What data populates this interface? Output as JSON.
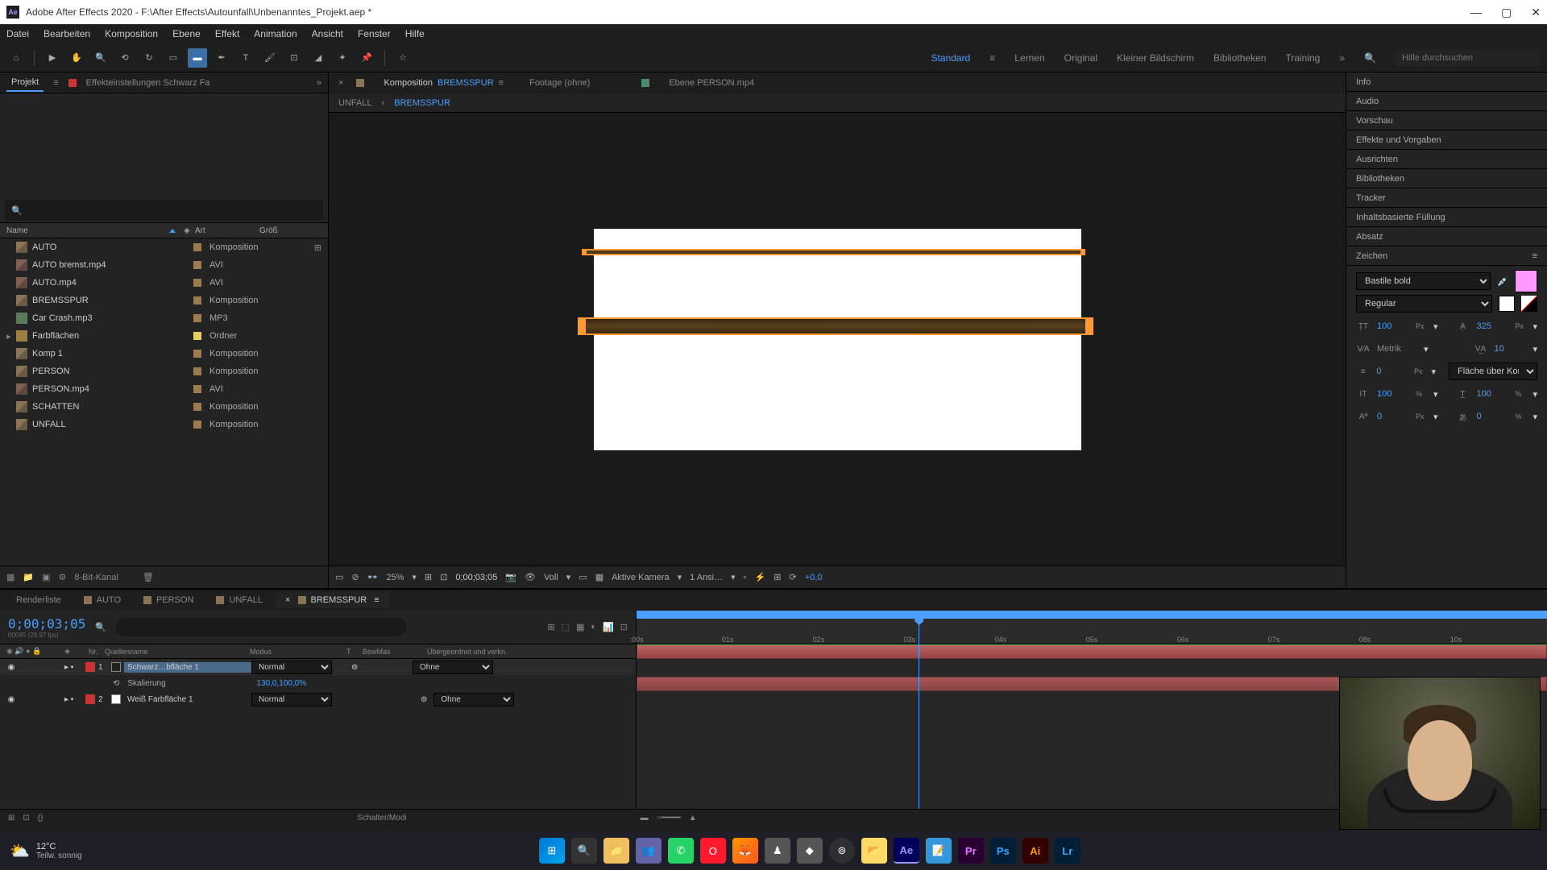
{
  "titlebar": {
    "app": "Adobe After Effects 2020",
    "path": "F:\\After Effects\\Autounfall\\Unbenanntes_Projekt.aep *"
  },
  "menubar": [
    "Datei",
    "Bearbeiten",
    "Komposition",
    "Ebene",
    "Effekt",
    "Animation",
    "Ansicht",
    "Fenster",
    "Hilfe"
  ],
  "workspaces": {
    "items": [
      "Standard",
      "Lernen",
      "Original",
      "Kleiner Bildschirm",
      "Bibliotheken",
      "Training"
    ],
    "active": "Standard",
    "search_placeholder": "Hilfe durchsuchen"
  },
  "project": {
    "tab": "Projekt",
    "effect_settings": "Effekteinstellungen Schwarz Fa",
    "columns": {
      "name": "Name",
      "type": "Art",
      "size": "Größ"
    },
    "items": [
      {
        "name": "AUTO",
        "type": "Komposition",
        "color": "#9e7b4f",
        "icon": "comp",
        "has_sub": true
      },
      {
        "name": "AUTO bremst.mp4",
        "type": "AVI",
        "color": "#9e7b4f",
        "icon": "avi"
      },
      {
        "name": "AUTO.mp4",
        "type": "AVI",
        "color": "#9e7b4f",
        "icon": "avi"
      },
      {
        "name": "BREMSSPUR",
        "type": "Komposition",
        "color": "#9e7b4f",
        "icon": "comp"
      },
      {
        "name": "Car Crash.mp3",
        "type": "MP3",
        "color": "#9e7b4f",
        "icon": "mp3"
      },
      {
        "name": "Farbflächen",
        "type": "Ordner",
        "color": "#e8d060",
        "icon": "folder",
        "expandable": true
      },
      {
        "name": "Komp 1",
        "type": "Komposition",
        "color": "#9e7b4f",
        "icon": "comp"
      },
      {
        "name": "PERSON",
        "type": "Komposition",
        "color": "#9e7b4f",
        "icon": "comp"
      },
      {
        "name": "PERSON.mp4",
        "type": "AVI",
        "color": "#9e7b4f",
        "icon": "avi"
      },
      {
        "name": "SCHATTEN",
        "type": "Komposition",
        "color": "#9e7b4f",
        "icon": "comp"
      },
      {
        "name": "UNFALL",
        "type": "Komposition",
        "color": "#9e7b4f",
        "icon": "comp"
      }
    ],
    "bit_depth": "8-Bit-Kanal"
  },
  "comp": {
    "tab_prefix": "Komposition",
    "tab_name": "BREMSSPUR",
    "footage_tab": "Footage   (ohne)",
    "layer_tab": "Ebene  PERSON.mp4",
    "nav": {
      "parent": "UNFALL",
      "current": "BREMSSPUR"
    },
    "footer": {
      "zoom": "25%",
      "timecode": "0;00;03;05",
      "resolution": "Voll",
      "camera": "Aktive Kamera",
      "views": "1 Ansi…",
      "exposure": "+0,0"
    }
  },
  "right_panels": [
    "Info",
    "Audio",
    "Vorschau",
    "Effekte und Vorgaben",
    "Ausrichten",
    "Bibliotheken",
    "Tracker",
    "Inhaltsbasierte Füllung",
    "Absatz"
  ],
  "character": {
    "title": "Zeichen",
    "font": "Bastile bold",
    "style": "Regular",
    "size": "100",
    "size_unit": "Px",
    "leading": "325",
    "leading_unit": "Px",
    "kerning": "Metrik",
    "tracking": "10",
    "stroke": "0",
    "stroke_unit": "Px",
    "stroke_mode": "Fläche über Kon…",
    "vscale": "100",
    "vscale_unit": "%",
    "hscale": "100",
    "hscale_unit": "%",
    "baseline": "0",
    "baseline_unit": "Px",
    "tsume": "0",
    "tsume_unit": "%",
    "fill_color": "#ff99ff"
  },
  "timeline": {
    "tabs": [
      "Renderliste",
      "AUTO",
      "PERSON",
      "UNFALL",
      "BREMSSPUR"
    ],
    "active_tab": "BREMSSPUR",
    "timecode": "0;00;03;05",
    "frame_info": "00095 (29.97 fps)",
    "columns": {
      "num": "Nr.",
      "name": "Quellenname",
      "mode": "Modus",
      "t": "T",
      "bew": "BewMas",
      "parent": "Übergeordnet und verkn."
    },
    "layers": [
      {
        "num": "1",
        "name": "Schwarz…bfläche 1",
        "mode": "Normal",
        "parent": "Ohne",
        "color": "#cc3333",
        "selected": true
      },
      {
        "num": "2",
        "name": "Weiß Farbfläche 1",
        "mode": "Normal",
        "parent": "Ohne",
        "color": "#cc3333"
      }
    ],
    "property": {
      "name": "Skalierung",
      "value": "130,0,100,0%"
    },
    "ruler_ticks": [
      ":00s",
      "01s",
      "02s",
      "03s",
      "04s",
      "05s",
      "06s",
      "07s",
      "08s",
      "10s"
    ],
    "playhead_pos_pct": 31,
    "footer": "Schalter/Modi"
  },
  "taskbar": {
    "weather": {
      "temp": "12°C",
      "desc": "Teilw. sonnig"
    }
  }
}
